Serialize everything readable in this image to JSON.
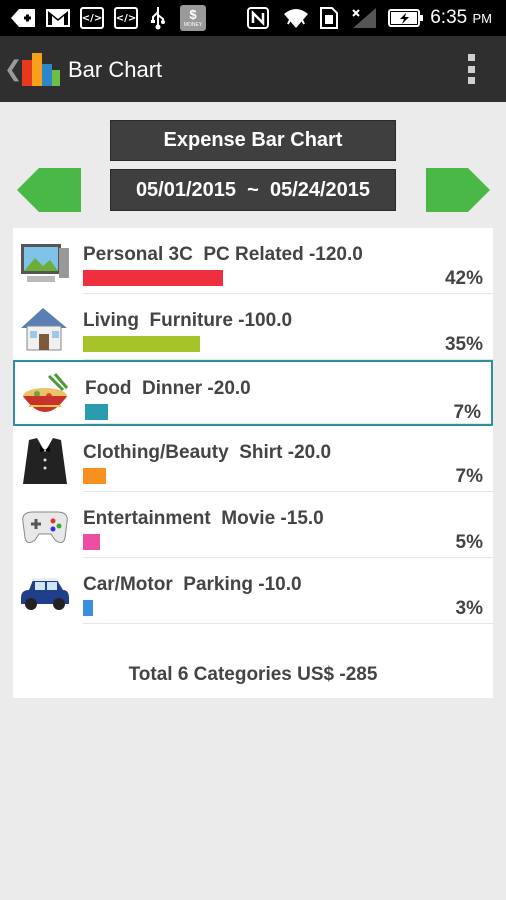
{
  "status_bar": {
    "time": "6:35",
    "ampm": "PM",
    "icons": [
      "add-icon",
      "gmail-icon",
      "code-icon",
      "code-icon",
      "usb-icon",
      "money-icon",
      "nfc-icon",
      "wifi-icon",
      "sim-icon",
      "signal-icon",
      "battery-charging-icon"
    ],
    "money_label": "MONEY"
  },
  "action_bar": {
    "title": "Bar Chart"
  },
  "header": {
    "chart_title": "Expense Bar Chart",
    "date_range": "05/01/2015  ~  05/24/2015"
  },
  "colors": {
    "accent_green": "#49b847",
    "selection": "#2e8fa0"
  },
  "chart_data": {
    "type": "bar",
    "title": "Expense Bar Chart",
    "categories": [
      "Personal 3C  PC Related",
      "Living  Furniture",
      "Food  Dinner",
      "Clothing/Beauty  Shirt",
      "Entertainment  Movie",
      "Car/Motor  Parking"
    ],
    "values": [
      -120.0,
      -100.0,
      -20.0,
      -20.0,
      -15.0,
      -10.0
    ],
    "percents": [
      42,
      35,
      7,
      7,
      5,
      3
    ]
  },
  "rows": [
    {
      "icon": "computer-icon",
      "label": "Personal 3C  PC Related -120.0",
      "pct": "42%",
      "fraction": 0.42,
      "color": "#ee2f3e"
    },
    {
      "icon": "house-icon",
      "label": "Living  Furniture -100.0",
      "pct": "35%",
      "fraction": 0.35,
      "color": "#a6c42a"
    },
    {
      "icon": "food-bowl-icon",
      "label": "Food  Dinner -20.0",
      "pct": "7%",
      "fraction": 0.07,
      "color": "#2b9bb0",
      "selected": true
    },
    {
      "icon": "tuxedo-icon",
      "label": "Clothing/Beauty  Shirt -20.0",
      "pct": "7%",
      "fraction": 0.07,
      "color": "#f7901e"
    },
    {
      "icon": "gamepad-icon",
      "label": "Entertainment  Movie -15.0",
      "pct": "5%",
      "fraction": 0.05,
      "color": "#ec4fa2"
    },
    {
      "icon": "car-icon",
      "label": "Car/Motor  Parking -10.0",
      "pct": "3%",
      "fraction": 0.03,
      "color": "#3a8ee0"
    }
  ],
  "total": "Total 6 Categories US$ -285"
}
